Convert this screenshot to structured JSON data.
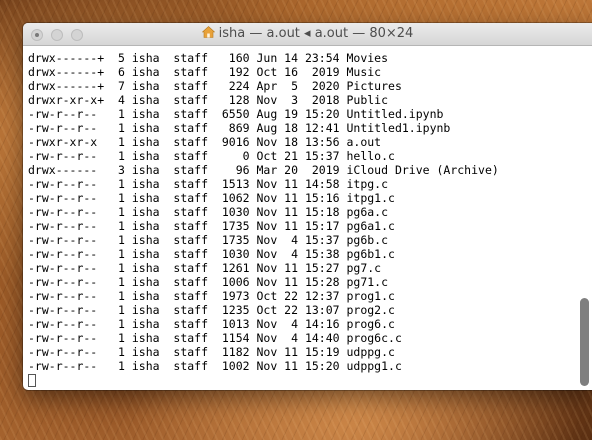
{
  "window": {
    "title": "isha — a.out ◂ a.out — 80×24"
  },
  "terminal": {
    "lines": [
      "drwx------+  5 isha  staff   160 Jun 14 23:54 Movies",
      "drwx------+  6 isha  staff   192 Oct 16  2019 Music",
      "drwx------+  7 isha  staff   224 Apr  5  2020 Pictures",
      "drwxr-xr-x+  4 isha  staff   128 Nov  3  2018 Public",
      "-rw-r--r--   1 isha  staff  6550 Aug 19 15:20 Untitled.ipynb",
      "-rw-r--r--   1 isha  staff   869 Aug 18 12:41 Untitled1.ipynb",
      "-rwxr-xr-x   1 isha  staff  9016 Nov 18 13:56 a.out",
      "-rw-r--r--   1 isha  staff     0 Oct 21 15:37 hello.c",
      "drwx------   3 isha  staff    96 Mar 20  2019 iCloud Drive (Archive)",
      "-rw-r--r--   1 isha  staff  1513 Nov 11 14:58 itpg.c",
      "-rw-r--r--   1 isha  staff  1062 Nov 11 15:16 itpg1.c",
      "-rw-r--r--   1 isha  staff  1030 Nov 11 15:18 pg6a.c",
      "-rw-r--r--   1 isha  staff  1735 Nov 11 15:17 pg6a1.c",
      "-rw-r--r--   1 isha  staff  1735 Nov  4 15:37 pg6b.c",
      "-rw-r--r--   1 isha  staff  1030 Nov  4 15:38 pg6b1.c",
      "-rw-r--r--   1 isha  staff  1261 Nov 11 15:27 pg7.c",
      "-rw-r--r--   1 isha  staff  1006 Nov 11 15:28 pg71.c",
      "-rw-r--r--   1 isha  staff  1973 Oct 22 12:37 prog1.c",
      "-rw-r--r--   1 isha  staff  1235 Oct 22 13:07 prog2.c",
      "-rw-r--r--   1 isha  staff  1013 Nov  4 14:16 prog6.c",
      "-rw-r--r--   1 isha  staff  1154 Nov  4 14:40 prog6c.c",
      "-rw-r--r--   1 isha  staff  1182 Nov 11 15:19 udppg.c",
      "-rw-r--r--   1 isha  staff  1002 Nov 11 15:20 udppg1.c"
    ]
  },
  "icons": {
    "title_icon": "home-icon",
    "close": "close-icon",
    "minimize": "minimize-icon",
    "zoom": "zoom-icon"
  },
  "colors": {
    "terminal_bg": "#ffffff",
    "terminal_fg": "#000000",
    "titlebar": "#e3e3e3",
    "home_icon": "#e8a23a"
  }
}
